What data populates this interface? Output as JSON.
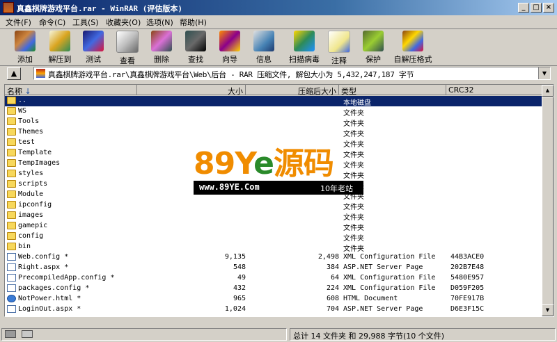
{
  "window": {
    "title": "真鑫棋牌游戏平台.rar - WinRAR (评估版本)"
  },
  "menu": [
    {
      "label": "文件(F)"
    },
    {
      "label": "命令(C)"
    },
    {
      "label": "工具(S)"
    },
    {
      "label": "收藏夹(O)"
    },
    {
      "label": "选项(N)"
    },
    {
      "label": "帮助(H)"
    }
  ],
  "toolbar": [
    {
      "label": "添加",
      "icon": "add-icon"
    },
    {
      "label": "解压到",
      "icon": "extract-to-icon"
    },
    {
      "label": "测试",
      "icon": "test-icon"
    },
    {
      "label": "查看",
      "icon": "view-icon"
    },
    {
      "label": "删除",
      "icon": "delete-icon"
    },
    {
      "label": "查找",
      "icon": "find-icon"
    },
    {
      "label": "向导",
      "icon": "wizard-icon"
    },
    {
      "label": "信息",
      "icon": "info-icon"
    },
    {
      "label": "扫描病毒",
      "icon": "virus-scan-icon"
    },
    {
      "label": "注释",
      "icon": "comment-icon"
    },
    {
      "label": "保护",
      "icon": "protect-icon"
    },
    {
      "label": "自解压格式",
      "icon": "sfx-icon"
    }
  ],
  "address": {
    "path": "真鑫棋牌游戏平台.rar\\真鑫棋牌游戏平台\\Web\\后台 - RAR 压缩文件, 解包大小为 5,432,247,187 字节"
  },
  "columns": {
    "name": "名称",
    "size": "大小",
    "packed": "压缩后大小",
    "type": "类型",
    "crc": "CRC32"
  },
  "files": [
    {
      "name": "..",
      "size": "",
      "packed": "",
      "type": "本地磁盘",
      "crc": "",
      "kind": "folder",
      "selected": true
    },
    {
      "name": "WS",
      "size": "",
      "packed": "",
      "type": "文件夹",
      "crc": "",
      "kind": "folder"
    },
    {
      "name": "Tools",
      "size": "",
      "packed": "",
      "type": "文件夹",
      "crc": "",
      "kind": "folder"
    },
    {
      "name": "Themes",
      "size": "",
      "packed": "",
      "type": "文件夹",
      "crc": "",
      "kind": "folder"
    },
    {
      "name": "test",
      "size": "",
      "packed": "",
      "type": "文件夹",
      "crc": "",
      "kind": "folder"
    },
    {
      "name": "Template",
      "size": "",
      "packed": "",
      "type": "文件夹",
      "crc": "",
      "kind": "folder"
    },
    {
      "name": "TempImages",
      "size": "",
      "packed": "",
      "type": "文件夹",
      "crc": "",
      "kind": "folder"
    },
    {
      "name": "styles",
      "size": "",
      "packed": "",
      "type": "文件夹",
      "crc": "",
      "kind": "folder"
    },
    {
      "name": "scripts",
      "size": "",
      "packed": "",
      "type": "文件夹",
      "crc": "",
      "kind": "folder"
    },
    {
      "name": "Module",
      "size": "",
      "packed": "",
      "type": "文件夹",
      "crc": "",
      "kind": "folder"
    },
    {
      "name": "ipconfig",
      "size": "",
      "packed": "",
      "type": "文件夹",
      "crc": "",
      "kind": "folder"
    },
    {
      "name": "images",
      "size": "",
      "packed": "",
      "type": "文件夹",
      "crc": "",
      "kind": "folder"
    },
    {
      "name": "gamepic",
      "size": "",
      "packed": "",
      "type": "文件夹",
      "crc": "",
      "kind": "folder"
    },
    {
      "name": "config",
      "size": "",
      "packed": "",
      "type": "文件夹",
      "crc": "",
      "kind": "folder"
    },
    {
      "name": "bin",
      "size": "",
      "packed": "",
      "type": "文件夹",
      "crc": "",
      "kind": "folder"
    },
    {
      "name": "Web.config *",
      "size": "9,135",
      "packed": "2,498",
      "type": "XML Configuration File",
      "crc": "44B3ACE0",
      "kind": "doc"
    },
    {
      "name": "Right.aspx *",
      "size": "548",
      "packed": "384",
      "type": "ASP.NET Server Page",
      "crc": "202B7E48",
      "kind": "doc"
    },
    {
      "name": "PrecompiledApp.config *",
      "size": "49",
      "packed": "64",
      "type": "XML Configuration File",
      "crc": "5480E957",
      "kind": "doc"
    },
    {
      "name": "packages.config *",
      "size": "432",
      "packed": "224",
      "type": "XML Configuration File",
      "crc": "D059F205",
      "kind": "doc"
    },
    {
      "name": "NotPower.html *",
      "size": "965",
      "packed": "608",
      "type": "HTML Document",
      "crc": "70FE917B",
      "kind": "html"
    },
    {
      "name": "LoginOut.aspx *",
      "size": "1,024",
      "packed": "704",
      "type": "ASP.NET Server Page",
      "crc": "D6E3F15C",
      "kind": "doc"
    }
  ],
  "status": {
    "left": "",
    "right": "总计 14 文件夹 和 29,988 字节(10 个文件)"
  },
  "watermark": {
    "logo_text_a": "89Y",
    "logo_text_e": "e",
    "logo_text_b": "源码",
    "url": "www.89YE.Com",
    "slogan": "10年老站"
  }
}
